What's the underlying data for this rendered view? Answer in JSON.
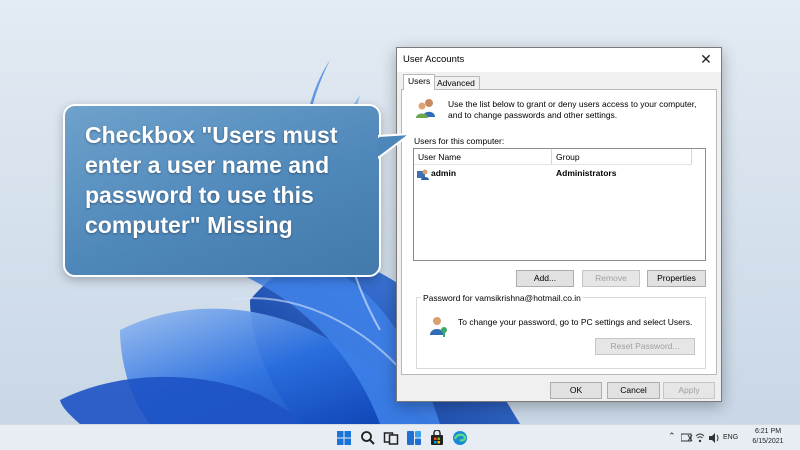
{
  "callout": {
    "text": "Checkbox \"Users must\nenter a user name and\npassword to use this\ncomputer\" Missing"
  },
  "dialog": {
    "title": "User Accounts",
    "close_glyph": "✕",
    "tabs": [
      {
        "label": "Users",
        "selected": true
      },
      {
        "label": "Advanced",
        "selected": false
      }
    ],
    "intro_text": "Use the list below to grant or deny users access to your computer, and to change passwords and other settings.",
    "users_section_label": "Users for this computer:",
    "table": {
      "columns": [
        "User Name",
        "Group"
      ],
      "rows": [
        {
          "user_name": "admin",
          "group": "Administrators",
          "icon": "user-icon"
        }
      ]
    },
    "buttons": {
      "add": "Add...",
      "remove": "Remove",
      "properties": "Properties"
    },
    "password_group": {
      "label": "Password for vamsikrishna@hotmail.co.in",
      "text": "To change your password, go to PC settings and select Users.",
      "reset_button": "Reset Password..."
    },
    "footer": {
      "ok": "OK",
      "cancel": "Cancel",
      "apply": "Apply"
    }
  },
  "taskbar": {
    "icons": [
      "windows-start-icon",
      "search-icon",
      "task-view-icon",
      "widgets-icon",
      "store-icon",
      "edge-icon"
    ],
    "tray": {
      "language": "ENG",
      "time": "6:21 PM",
      "date": "6/15/2021"
    }
  },
  "colors": {
    "callout_fill": "#4f88ba",
    "wallpaper_bloom": "#1f5fd6",
    "taskbar_bg": "#e8edf3"
  }
}
